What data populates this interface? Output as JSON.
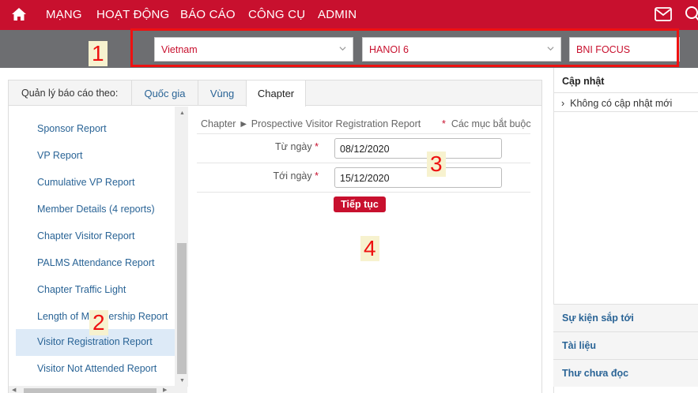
{
  "nav": {
    "items": [
      "MẠNG",
      "HOẠT ĐỘNG",
      "BÁO CÁO",
      "CÔNG CỤ",
      "ADMIN"
    ],
    "icons": [
      "home-icon",
      "mail-icon",
      "search-icon"
    ]
  },
  "filters": {
    "country": "Vietnam",
    "region": "HANOI 6",
    "chapter": "BNI FOCUS"
  },
  "annotations": [
    "1",
    "2",
    "3",
    "4"
  ],
  "tabs": {
    "label": "Quản lý báo cáo theo:",
    "items": [
      "Quốc gia",
      "Vùng",
      "Chapter"
    ],
    "active": "Chapter"
  },
  "reports": [
    "Sponsor Report",
    "VP Report",
    "Cumulative VP Report",
    "Member Details (4 reports)",
    "Chapter Visitor Report",
    "PALMS Attendance Report",
    "Chapter Traffic Light",
    "Length of Membership Report",
    "Visitor Registration Report",
    "Visitor Not Attended Report"
  ],
  "selected_report": "Visitor Registration Report",
  "form": {
    "breadcrumb": "Chapter ► Prospective Visitor Registration Report",
    "required_note": "Các mục bắt buộc",
    "from_label": "Từ ngày",
    "from_value": "08/12/2020",
    "to_label": "Tới ngày",
    "to_value": "15/12/2020",
    "continue_label": "Tiếp tục"
  },
  "right_panel": {
    "title": "Cập nhật",
    "no_updates": "Không có cập nhật mới",
    "sections": [
      "Sự kiện sắp tới",
      "Tài liệu",
      "Thư chưa đọc"
    ]
  },
  "colors": {
    "brand_red": "#c8102e",
    "filter_bar": "#6d6e71",
    "link_blue": "#2a6496",
    "annotation_red": "#e11111"
  }
}
